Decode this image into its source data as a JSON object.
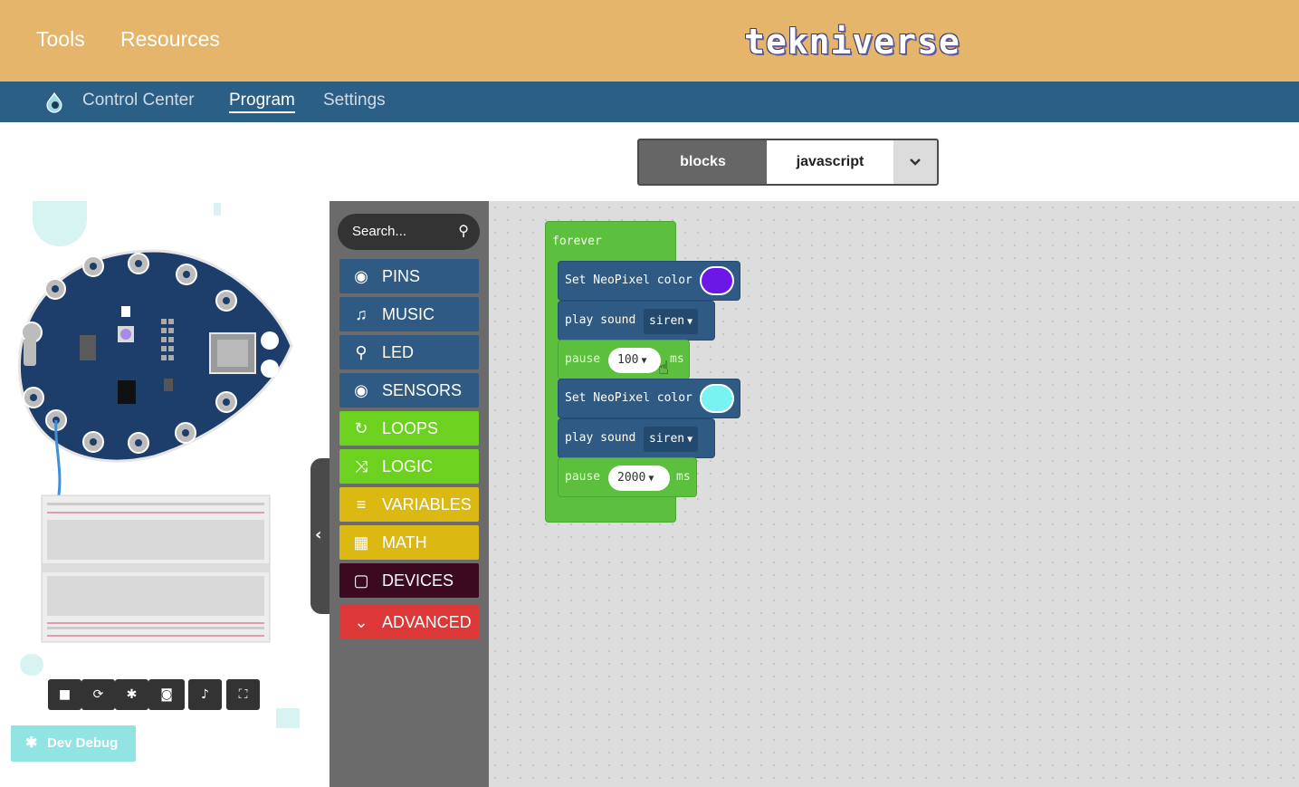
{
  "topbar": {
    "links": [
      "Tools",
      "Resources"
    ],
    "logo": "tekniverse"
  },
  "subnav": {
    "items": [
      "Control Center",
      "Program",
      "Settings"
    ],
    "active": "Program"
  },
  "editor_toggle": {
    "blocks_label": "blocks",
    "javascript_label": "javascript"
  },
  "toolbox": {
    "search_placeholder": "Search...",
    "categories": [
      {
        "label": "PINS",
        "color": "#2e5a84",
        "icon": "target-icon"
      },
      {
        "label": "MUSIC",
        "color": "#2e5a84",
        "icon": "music-note-icon"
      },
      {
        "label": "LED",
        "color": "#2e5a84",
        "icon": "lightbulb-icon"
      },
      {
        "label": "SENSORS",
        "color": "#2e5a84",
        "icon": "target-icon"
      },
      {
        "label": "LOOPS",
        "color": "#6dd11f",
        "icon": "refresh-icon"
      },
      {
        "label": "LOGIC",
        "color": "#6dd11f",
        "icon": "shuffle-icon"
      },
      {
        "label": "VARIABLES",
        "color": "#dcb813",
        "icon": "list-icon"
      },
      {
        "label": "MATH",
        "color": "#dcb813",
        "icon": "calculator-icon"
      },
      {
        "label": "DEVICES",
        "color": "#3b0a20",
        "icon": "square-icon"
      },
      {
        "label": "ADVANCED",
        "color": "#dd3838",
        "icon": "chevron-down-icon"
      }
    ]
  },
  "program": {
    "loop_label": "forever",
    "set_color_label": "Set NeoPixel color",
    "play_sound_label": "play sound",
    "pause_label": "pause",
    "ms_label": "ms",
    "steps": [
      {
        "type": "set_color",
        "color": "#6b17e6"
      },
      {
        "type": "play_sound",
        "sound": "siren"
      },
      {
        "type": "pause",
        "value": "100"
      },
      {
        "type": "set_color",
        "color": "#79f2f2"
      },
      {
        "type": "play_sound",
        "sound": "siren"
      },
      {
        "type": "pause",
        "value": "2000"
      }
    ]
  },
  "simulator": {
    "dev_debug_label": "Dev Debug",
    "controls": [
      "stop-icon",
      "restart-icon",
      "debug-icon",
      "screenshot-icon",
      "sound-icon",
      "fullscreen-icon"
    ]
  }
}
